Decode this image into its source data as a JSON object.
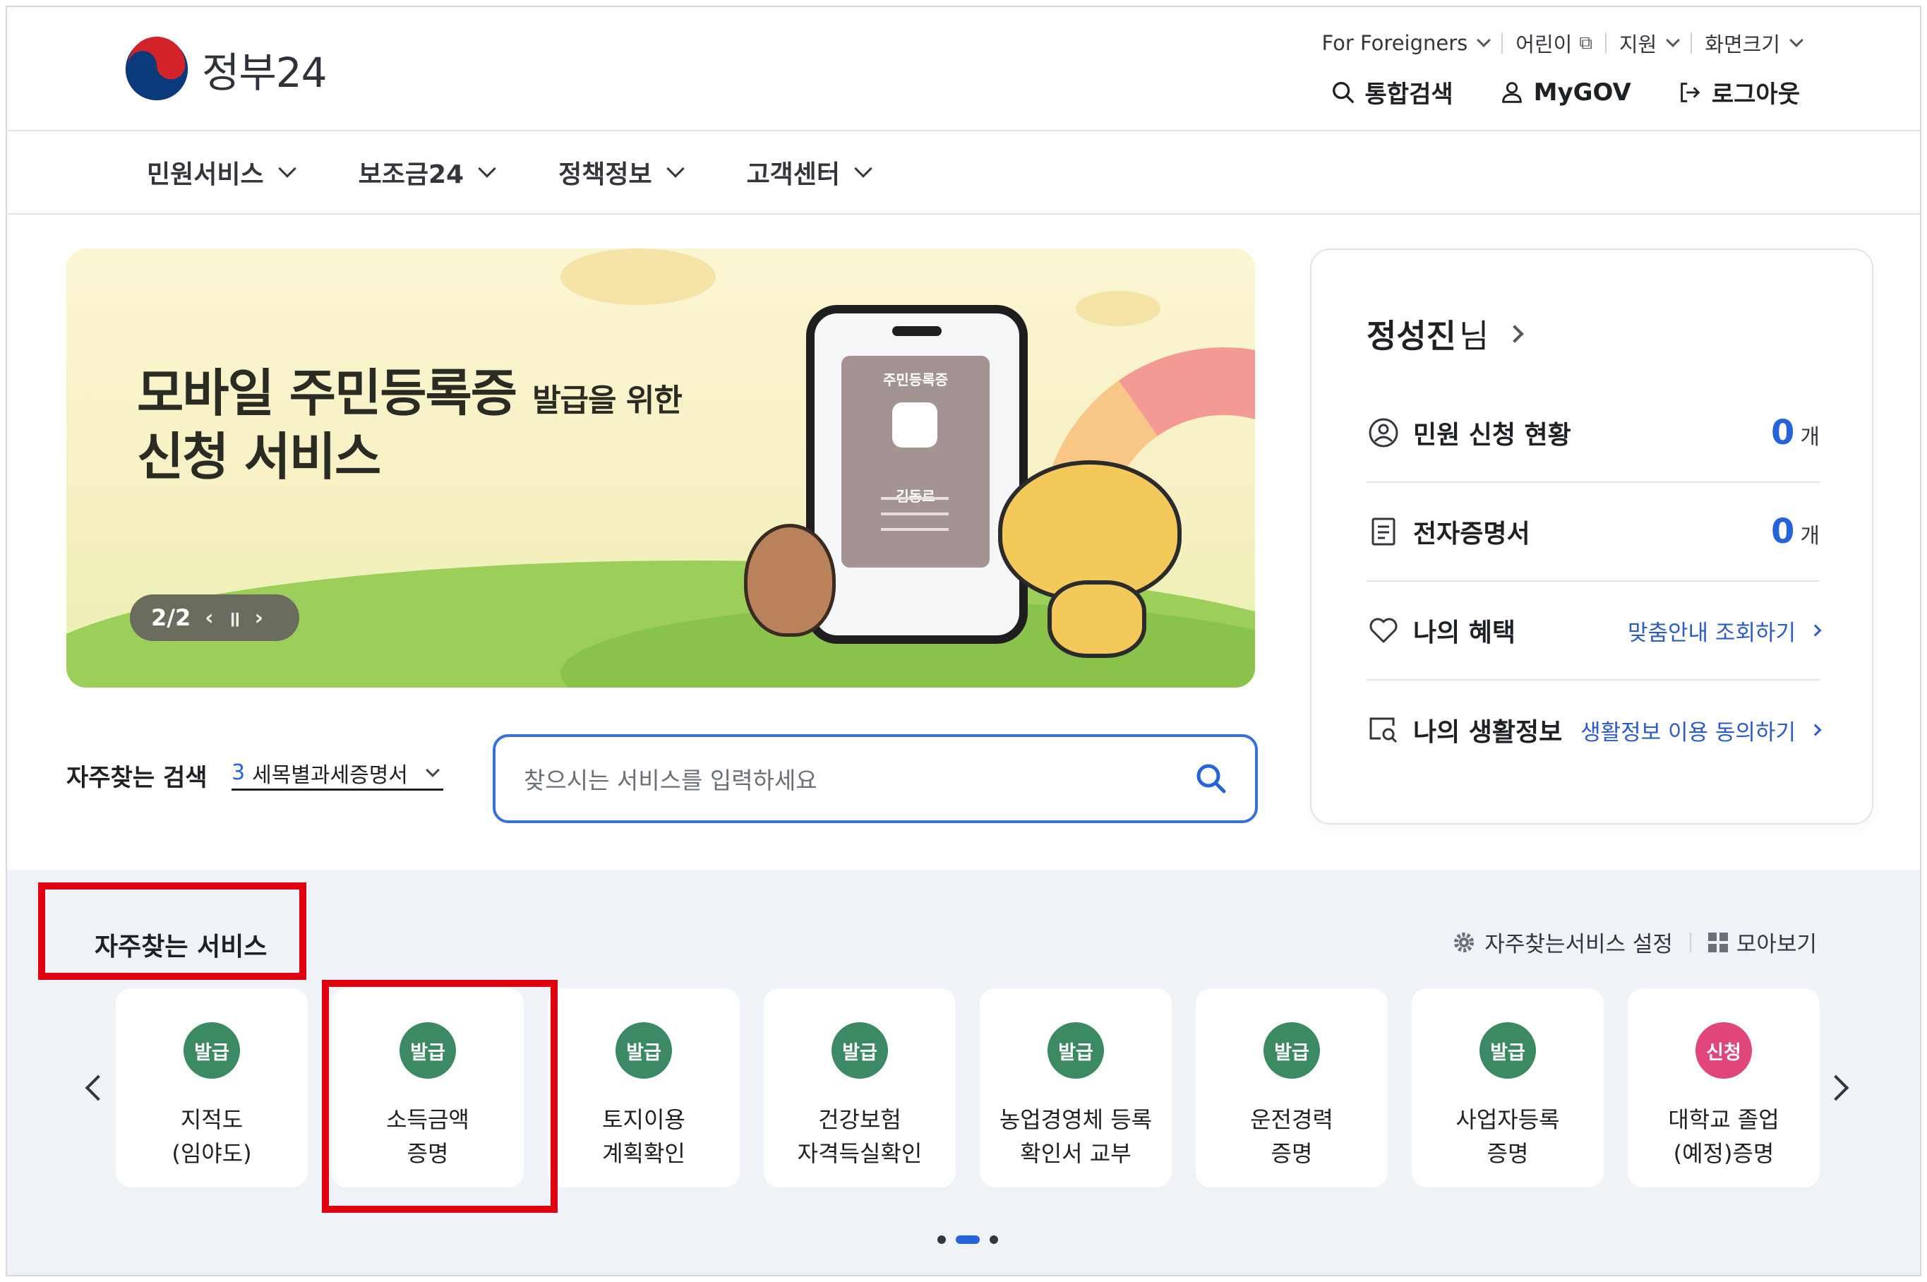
{
  "brand": {
    "name": "정부24",
    "colors": {
      "primary": "#2563d9",
      "badge_issue": "#3c8a63",
      "badge_apply": "#e0457b",
      "highlight": "#e0000e"
    }
  },
  "utility": {
    "foreigners": "For Foreigners",
    "kids": "어린이",
    "support": "지원",
    "screen_size": "화면크기"
  },
  "account": {
    "search": "통합검색",
    "mygov": "MyGOV",
    "logout": "로그아웃"
  },
  "gnb": [
    "민원서비스",
    "보조금24",
    "정책정보",
    "고객센터"
  ],
  "banner": {
    "title_main": "모바일 주민등록증",
    "title_small": "발급을 위한",
    "title_line2": "신청 서비스",
    "counter": "2/2",
    "card_title": "주민등록증",
    "card_name": "김동로"
  },
  "profile": {
    "name": "정성진",
    "suffix": "님",
    "rows": [
      {
        "icon": "person-circle-icon",
        "label": "민원 신청 현황",
        "count": "0",
        "unit": "개"
      },
      {
        "icon": "document-list-icon",
        "label": "전자증명서",
        "count": "0",
        "unit": "개"
      },
      {
        "icon": "heart-icon",
        "label": "나의 혜택",
        "link": "맞춤안내 조회하기"
      },
      {
        "icon": "search-window-icon",
        "label": "나의 생활정보",
        "link": "생활정보 이용 동의하기"
      }
    ]
  },
  "frequent_search": {
    "label": "자주찾는 검색",
    "rank": "3",
    "term": "세목별과세증명서"
  },
  "search": {
    "placeholder": "찾으시는 서비스를 입력하세요"
  },
  "services": {
    "title": "자주찾는 서비스",
    "settings": "자주찾는서비스 설정",
    "view_all": "모아보기",
    "items": [
      {
        "badge": "발급",
        "name": "지적도\n(임야도)"
      },
      {
        "badge": "발급",
        "name": "소득금액\n증명"
      },
      {
        "badge": "발급",
        "name": "토지이용\n계획확인"
      },
      {
        "badge": "발급",
        "name": "건강보험\n자격득실확인"
      },
      {
        "badge": "발급",
        "name": "농업경영체 등록\n확인서 교부"
      },
      {
        "badge": "발급",
        "name": "운전경력\n증명"
      },
      {
        "badge": "발급",
        "name": "사업자등록\n증명"
      },
      {
        "badge": "신청",
        "name": "대학교 졸업\n(예정)증명"
      }
    ]
  }
}
